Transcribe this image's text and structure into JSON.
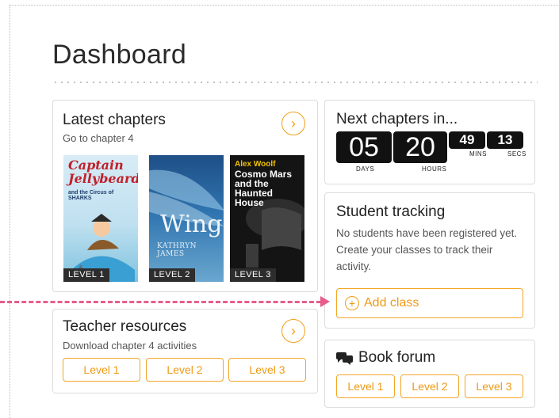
{
  "page": {
    "title": "Dashboard"
  },
  "latest": {
    "title": "Latest chapters",
    "subtitle": "Go to chapter 4",
    "books": [
      {
        "cover_title": "Captain Jellybeard",
        "cover_subtitle": "and the Circus of SHARKS",
        "level": "LEVEL 1"
      },
      {
        "cover_title": "Wings",
        "cover_author": "KATHRYN JAMES",
        "level": "LEVEL 2"
      },
      {
        "cover_author": "Alex Woolf",
        "cover_title": "Cosmo Mars and the Haunted House",
        "level": "LEVEL 3"
      }
    ]
  },
  "next": {
    "title": "Next chapters in...",
    "days": "05",
    "hours": "20",
    "mins": "49",
    "secs": "13",
    "days_label": "DAYS",
    "hours_label": "HOURS",
    "mins_label": "MINS",
    "secs_label": "SECS"
  },
  "tracking": {
    "title": "Student tracking",
    "message": "No students have been registered yet. Create your classes to track their activity.",
    "add_label": "Add class"
  },
  "teacher": {
    "title": "Teacher resources",
    "subtitle": "Download chapter 4 activities",
    "levels": [
      "Level 1",
      "Level 2",
      "Level 3"
    ]
  },
  "forum": {
    "title": "Book forum",
    "levels": [
      "Level 1",
      "Level 2",
      "Level 3"
    ]
  },
  "colors": {
    "accent": "#f0a018",
    "pointer": "#e85c8c",
    "dark": "#111111"
  },
  "icons": {
    "next": "chevron-right-circle-icon",
    "add": "plus-circle-icon",
    "forum": "chat-bubbles-icon"
  }
}
